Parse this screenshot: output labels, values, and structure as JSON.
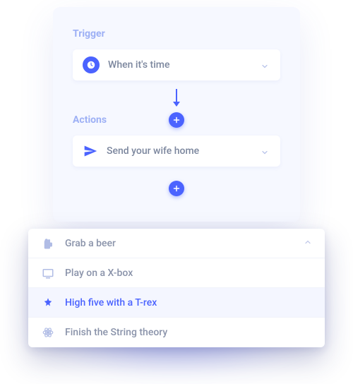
{
  "accent": "#4b63ff",
  "trigger": {
    "label": "Trigger",
    "select": {
      "icon": "clock-icon",
      "text": "When it's time"
    }
  },
  "actions": {
    "label": "Actions",
    "select": {
      "icon": "send-icon",
      "text": "Send your wife home"
    }
  },
  "dropdown": {
    "items": [
      {
        "icon": "beer-icon",
        "label": "Grab a beer",
        "selected": false,
        "collapse": true
      },
      {
        "icon": "tv-icon",
        "label": "Play on a X-box",
        "selected": false
      },
      {
        "icon": "footprint-icon",
        "label": "High five with a T-rex",
        "selected": true
      },
      {
        "icon": "atom-icon",
        "label": "Finish the String theory",
        "selected": false
      }
    ]
  }
}
